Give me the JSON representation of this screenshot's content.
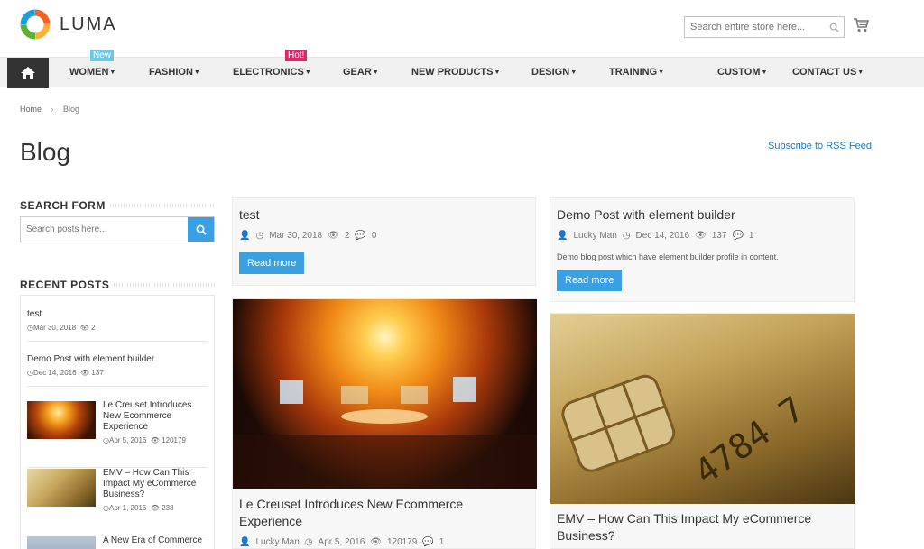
{
  "brand": {
    "name": "LUMA"
  },
  "header": {
    "search_placeholder": "Search entire store here...",
    "cart_icon": "cart-icon"
  },
  "nav": {
    "items": [
      {
        "label": "WOMEN",
        "badge": "New"
      },
      {
        "label": "FASHION"
      },
      {
        "label": "ELECTRONICS",
        "badge": "Hot!"
      },
      {
        "label": "GEAR"
      },
      {
        "label": "NEW PRODUCTS"
      },
      {
        "label": "DESIGN"
      },
      {
        "label": "TRAINING"
      },
      {
        "label": "CUSTOM"
      },
      {
        "label": "CONTACT US"
      }
    ]
  },
  "breadcrumb": {
    "home": "Home",
    "current": "Blog"
  },
  "page": {
    "title": "Blog",
    "rss": "Subscribe to RSS Feed"
  },
  "sidebar": {
    "search_heading": "SEARCH FORM",
    "search_placeholder": "Search posts here...",
    "recent_heading": "RECENT POSTS",
    "recent": [
      {
        "title": "test",
        "date": "Mar 30, 2018",
        "views": "2"
      },
      {
        "title": "Demo Post with element builder",
        "date": "Dec 14, 2016",
        "views": "137"
      },
      {
        "title": "Le Creuset Introduces New Ecommerce Experience",
        "date": "Apr 5, 2016",
        "views": "120179"
      },
      {
        "title": "EMV – How Can This Impact My eCommerce Business?",
        "date": "Apr 1, 2016",
        "views": "238"
      },
      {
        "title": "A New Era of Commerce"
      }
    ]
  },
  "posts": [
    {
      "title": "test",
      "date": "Mar 30, 2018",
      "views": "2",
      "comments": "0",
      "read_more": "Read more"
    },
    {
      "title": "Demo Post with element builder",
      "author": "Lucky Man",
      "date": "Dec 14, 2016",
      "views": "137",
      "comments": "1",
      "excerpt": "Demo blog post which have element builder profile in content.",
      "read_more": "Read more"
    },
    {
      "title": "Le Creuset Introduces New Ecommerce Experience",
      "author": "Lucky Man",
      "date": "Apr 5, 2016",
      "views": "120179",
      "comments": "1"
    },
    {
      "title": "EMV – How Can This Impact My eCommerce Business?"
    }
  ],
  "colors": {
    "accent": "#3aa0e1",
    "new_badge": "#6ac8e8",
    "hot_badge": "#e2246a",
    "nav_bg": "#f0f0f0",
    "link": "#1979c3"
  }
}
